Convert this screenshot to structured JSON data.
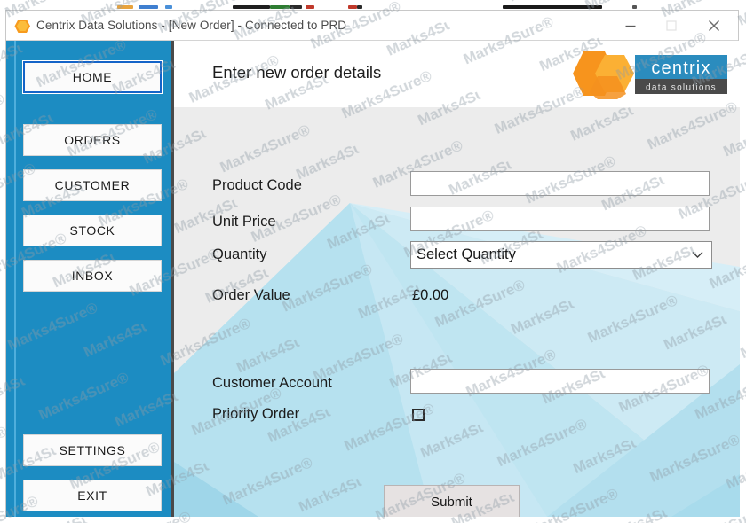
{
  "window": {
    "title": "Centrix Data Solutions - [New Order] - Connected to PRD",
    "app_icon": "hexagon-orange-icon",
    "controls": {
      "minimize": "minimize-icon",
      "maximize": "maximize-icon",
      "close": "close-icon"
    }
  },
  "sidebar": {
    "items": [
      {
        "label": "HOME",
        "focused": true
      },
      {
        "label": "ORDERS",
        "focused": false
      },
      {
        "label": "CUSTOMER",
        "focused": false
      },
      {
        "label": "STOCK",
        "focused": false
      },
      {
        "label": "INBOX",
        "focused": false
      }
    ],
    "bottom_items": [
      {
        "label": "SETTINGS"
      },
      {
        "label": "EXIT"
      }
    ]
  },
  "header": {
    "title": "Enter new order details",
    "logo": {
      "name": "centrix",
      "tagline": "data solutions"
    }
  },
  "form": {
    "product_code": {
      "label": "Product Code",
      "value": "",
      "placeholder": ""
    },
    "unit_price": {
      "label": "Unit Price",
      "value": "",
      "placeholder": ""
    },
    "quantity": {
      "label": "Quantity",
      "selected": "Select Quantity",
      "options": [
        "Select Quantity"
      ]
    },
    "order_value": {
      "label": "Order Value",
      "value": "£0.00"
    },
    "customer_account": {
      "label": "Customer Account",
      "value": "",
      "placeholder": ""
    },
    "priority_order": {
      "label": "Priority Order",
      "checked": false
    },
    "submit": {
      "label": "Submit"
    }
  },
  "watermark": {
    "text": "Marks4Sure®"
  },
  "colors": {
    "sidebar_blue": "#1c8cc2",
    "logo_blue": "#2b8cbe",
    "logo_orange": "#f7941d",
    "focus_blue": "#1464c8",
    "panel_gray": "#ececec",
    "panel_blue": "#bfe3f0"
  }
}
